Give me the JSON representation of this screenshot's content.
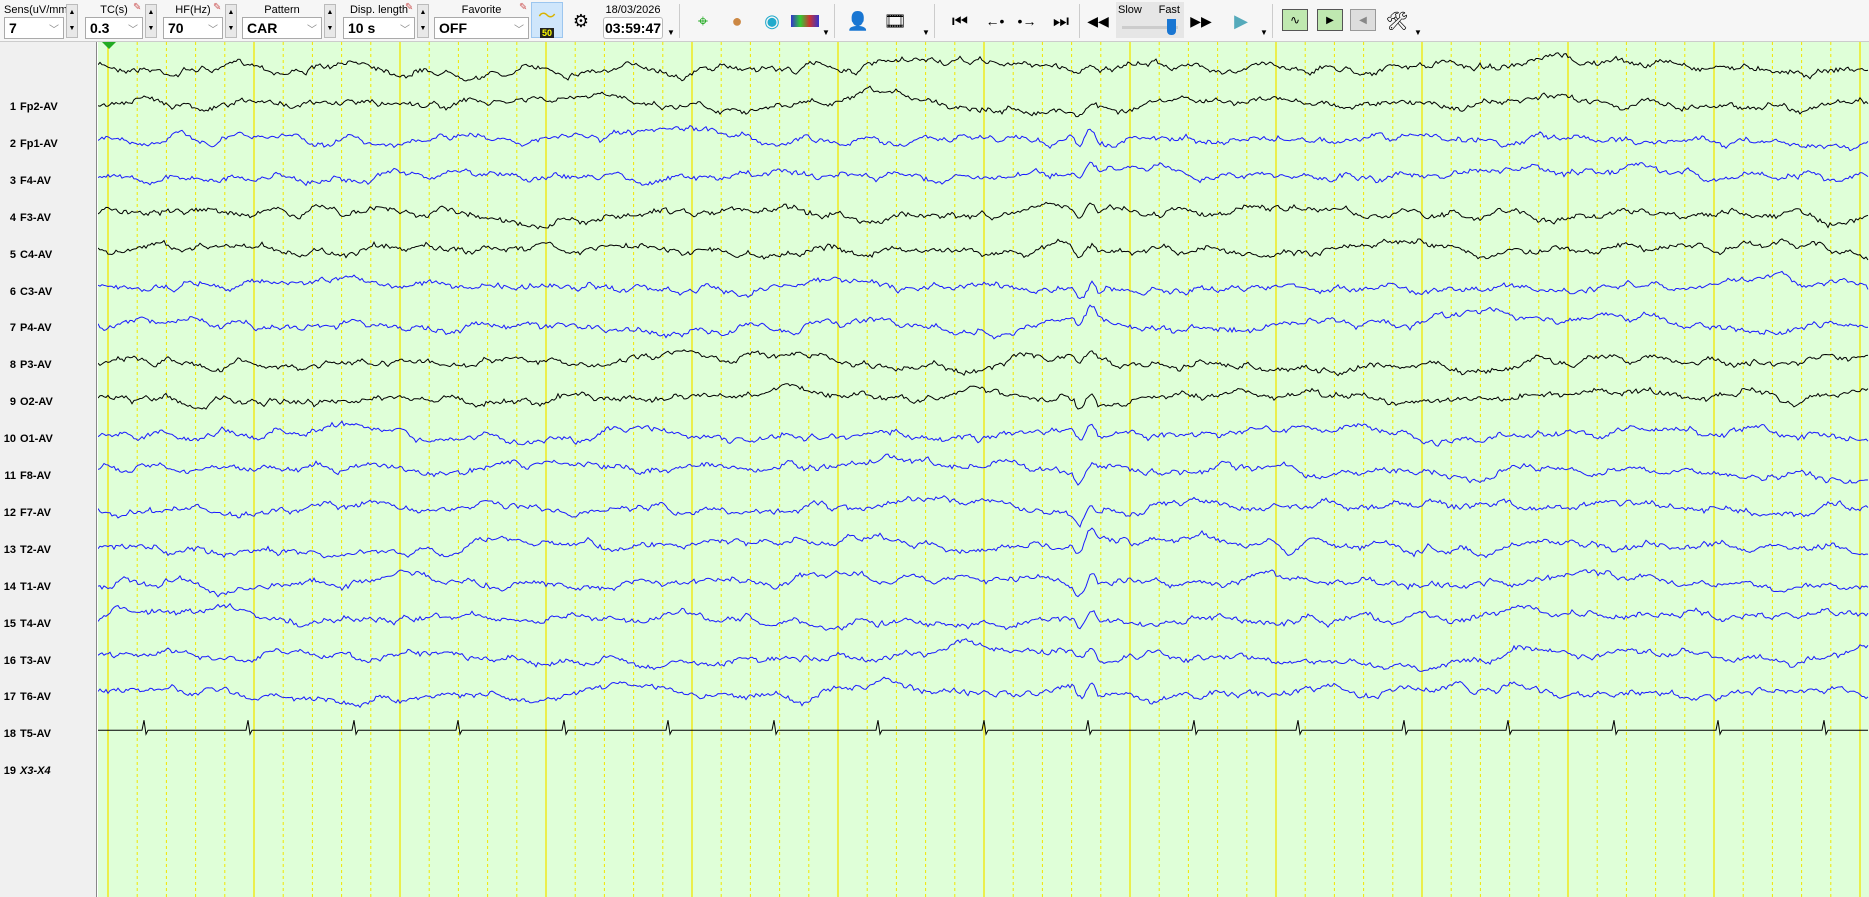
{
  "toolbar": {
    "sens": {
      "label": "Sens(uV/mm)",
      "value": "7"
    },
    "tc": {
      "label": "TC(s)",
      "value": "0.3"
    },
    "hf": {
      "label": "HF(Hz)",
      "value": "70"
    },
    "pattern": {
      "label": "Pattern",
      "value": "CAR"
    },
    "disp": {
      "label": "Disp. length",
      "value": "10 s"
    },
    "favorite": {
      "label": "Favorite",
      "value": "OFF"
    },
    "notch_badge": "50",
    "date": "18/03/2026",
    "time": "03:59:47",
    "speed": {
      "slow": "Slow",
      "fast": "Fast",
      "value": 0.9
    }
  },
  "channels": [
    {
      "n": "1",
      "label": "Fp2-AV",
      "color": "#000000"
    },
    {
      "n": "2",
      "label": "Fp1-AV",
      "color": "#000000"
    },
    {
      "n": "3",
      "label": "F4-AV",
      "color": "#1a1aff"
    },
    {
      "n": "4",
      "label": "F3-AV",
      "color": "#1a1aff"
    },
    {
      "n": "5",
      "label": "C4-AV",
      "color": "#000000"
    },
    {
      "n": "6",
      "label": "C3-AV",
      "color": "#000000"
    },
    {
      "n": "7",
      "label": "P4-AV",
      "color": "#1a1aff"
    },
    {
      "n": "8",
      "label": "P3-AV",
      "color": "#1a1aff"
    },
    {
      "n": "9",
      "label": "O2-AV",
      "color": "#000000"
    },
    {
      "n": "10",
      "label": "O1-AV",
      "color": "#000000"
    },
    {
      "n": "11",
      "label": "F8-AV",
      "color": "#1a1aff"
    },
    {
      "n": "12",
      "label": "F7-AV",
      "color": "#1a1aff"
    },
    {
      "n": "13",
      "label": "T2-AV",
      "color": "#1a1aff"
    },
    {
      "n": "14",
      "label": "T1-AV",
      "color": "#1a1aff"
    },
    {
      "n": "15",
      "label": "T4-AV",
      "color": "#1a1aff"
    },
    {
      "n": "16",
      "label": "T3-AV",
      "color": "#1a1aff"
    },
    {
      "n": "17",
      "label": "T6-AV",
      "color": "#1a1aff"
    },
    {
      "n": "18",
      "label": "T5-AV",
      "color": "#1a1aff"
    },
    {
      "n": "19",
      "label": "X3-X4",
      "color": "#000000"
    }
  ]
}
